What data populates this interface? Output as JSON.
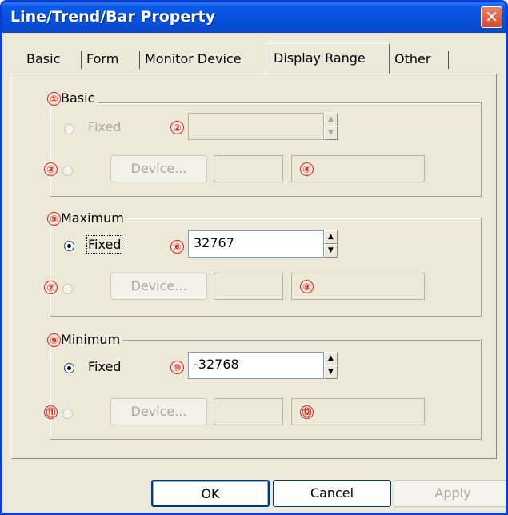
{
  "window": {
    "title": "Line/Trend/Bar Property",
    "close_icon": "close-icon"
  },
  "tabs": [
    "Basic",
    "Form",
    "Monitor Device",
    "Display Range",
    "Other"
  ],
  "active_tab": "Display Range",
  "groups": {
    "basic": {
      "label": "Basic",
      "num": "①",
      "fixed_label": "Fixed",
      "fixed_num": "②",
      "fixed_value": "",
      "device_num": "③",
      "device_label": "Device...",
      "device_value": "",
      "device_comment_num": "④"
    },
    "maximum": {
      "label": "Maximum",
      "num": "⑤",
      "fixed_label": "Fixed",
      "fixed_num": "⑥",
      "fixed_value": "32767",
      "device_num": "⑦",
      "device_label": "Device...",
      "device_value": "",
      "device_comment_num": "⑧"
    },
    "minimum": {
      "label": "Minimum",
      "num": "⑨",
      "fixed_label": "Fixed",
      "fixed_num": "⑩",
      "fixed_value": "-32768",
      "device_num": "⑪",
      "device_label": "Device...",
      "device_value": "",
      "device_comment_num": "⑫"
    }
  },
  "buttons": {
    "ok": "OK",
    "cancel": "Cancel",
    "apply": "Apply"
  },
  "colors": {
    "titlebar": "#0550dd",
    "marker": "#e02020",
    "dialog_bg": "#ece9d8"
  }
}
